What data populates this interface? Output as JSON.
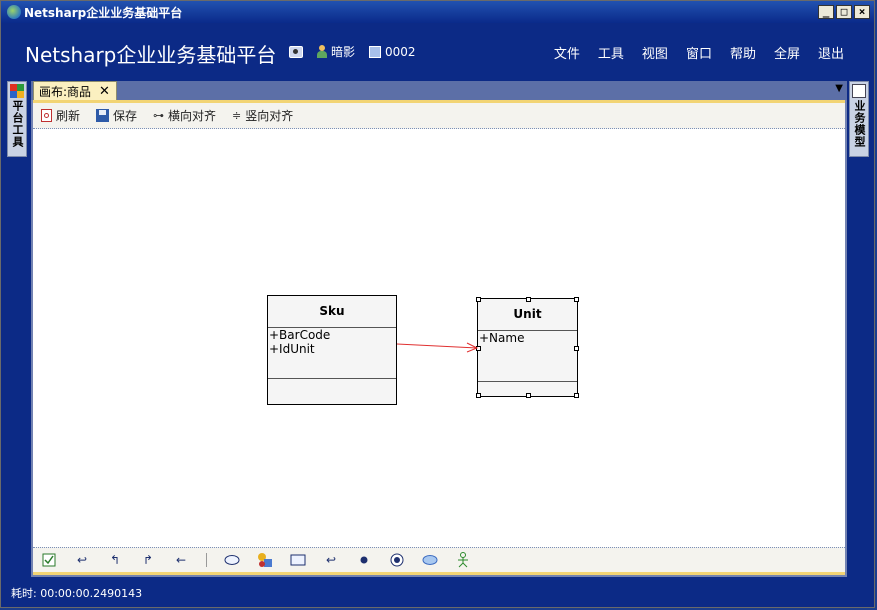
{
  "window": {
    "title": "Netsharp企业业务基础平台",
    "min": "_",
    "max": "□",
    "close": "×"
  },
  "header": {
    "app_title": "Netsharp企业业务基础平台",
    "user_name": "暗影",
    "terminal_code": "0002",
    "menu": [
      "文件",
      "工具",
      "视图",
      "窗口",
      "帮助",
      "全屏",
      "退出"
    ]
  },
  "side_left": {
    "label": "平台工具"
  },
  "side_right": {
    "label": "业务模型"
  },
  "tab": {
    "label": "画布:商品",
    "close": "✕"
  },
  "toolbar": {
    "refresh": "刷新",
    "save": "保存",
    "horizontal_align": "横向对齐",
    "vertical_align": "竖向对齐"
  },
  "diagram": {
    "classes": [
      {
        "name": "Sku",
        "attributes": [
          "+BarCode",
          "+IdUnit"
        ]
      },
      {
        "name": "Unit",
        "attributes": [
          "+Name"
        ]
      }
    ],
    "association": {
      "from": "Sku",
      "to": "Unit",
      "color": "#e03030"
    }
  },
  "bottom_tools": [
    "check",
    "arrow-back",
    "arrow-turn-left",
    "arrow-turn-right",
    "arrow-left",
    "ellipse",
    "shapes",
    "rectangle",
    "arrow-back-2",
    "dot",
    "target",
    "ellipse-filled",
    "actor"
  ],
  "status": {
    "elapsed": "耗时: 00:00:00.2490143"
  },
  "colors": {
    "header_bg": "#0c2a86",
    "tab_bg": "#fbf0c0",
    "toolbar_accent": "#f2d474"
  }
}
